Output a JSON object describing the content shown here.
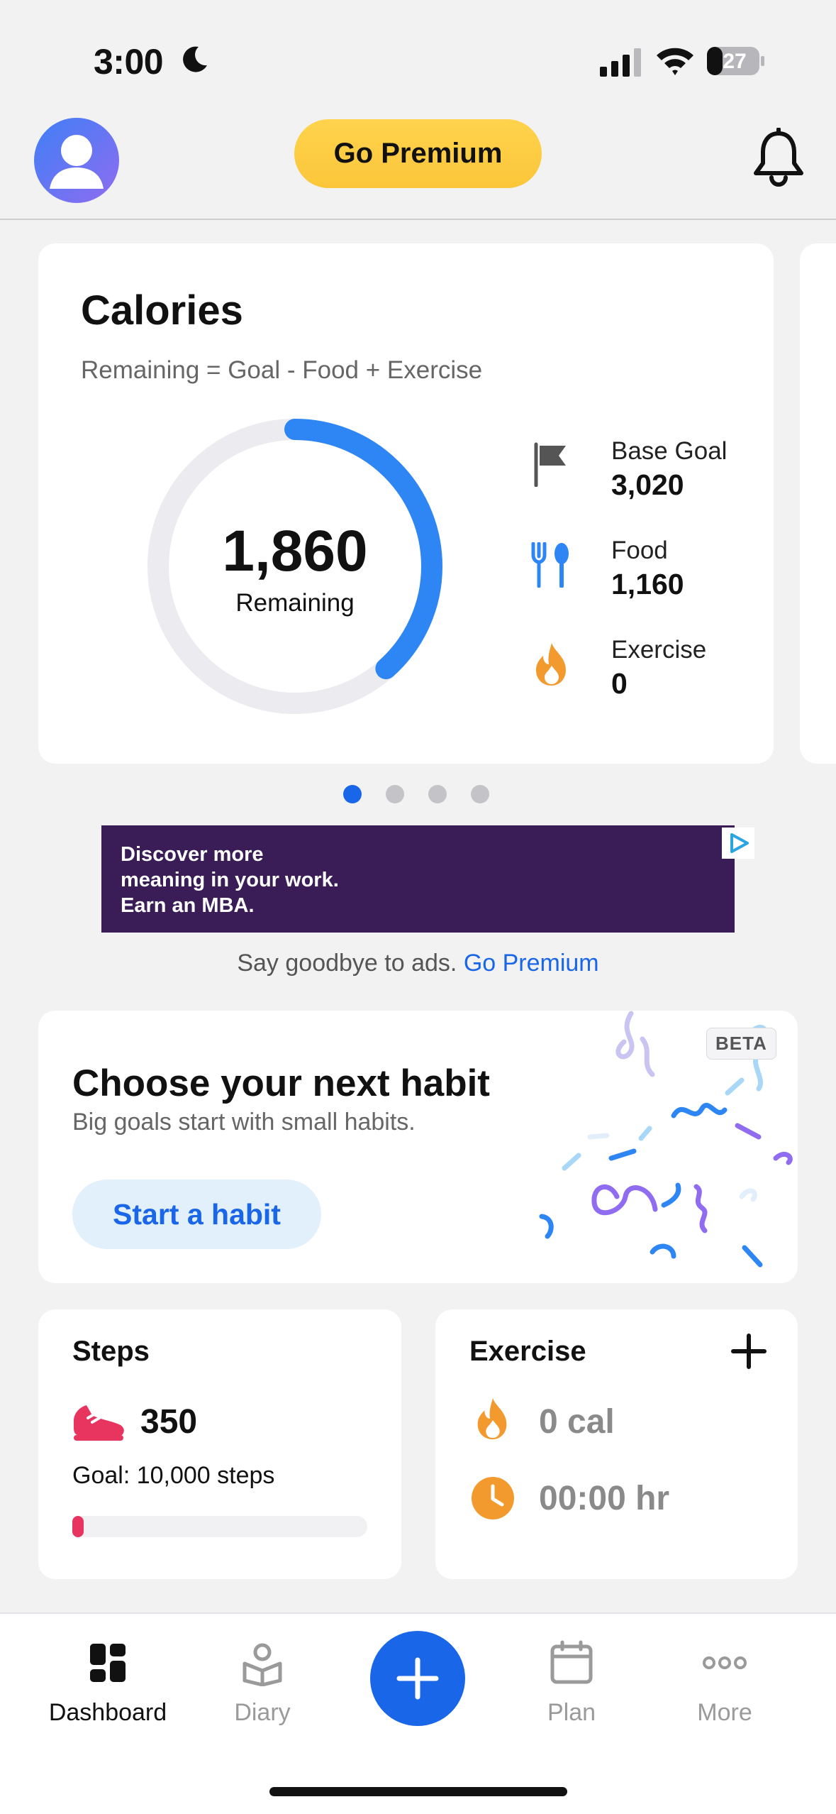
{
  "status_bar": {
    "time": "3:00",
    "battery": "27"
  },
  "header": {
    "premium_label": "Go Premium"
  },
  "calories": {
    "title": "Calories",
    "subtitle": "Remaining = Goal - Food + Exercise",
    "remaining_value": "1,860",
    "remaining_label": "Remaining",
    "ring_progress": 0.384,
    "stats": [
      {
        "label": "Base Goal",
        "value": "3,020",
        "icon": "flag-icon"
      },
      {
        "label": "Food",
        "value": "1,160",
        "icon": "fork-knife-icon"
      },
      {
        "label": "Exercise",
        "value": "0",
        "icon": "flame-icon"
      }
    ],
    "carousel_pages": 4,
    "carousel_active": 0
  },
  "ad": {
    "line1": "Discover more",
    "line2": "meaning in your work.",
    "line3": "Earn an MBA.",
    "note": "Say goodbye to ads.",
    "note_link": "Go Premium"
  },
  "habit": {
    "badge": "BETA",
    "title": "Choose your next habit",
    "subtitle": "Big goals start with small habits.",
    "button": "Start a habit"
  },
  "steps": {
    "title": "Steps",
    "value": "350",
    "goal": "Goal: 10,000 steps",
    "progress": 0.035
  },
  "exercise": {
    "title": "Exercise",
    "calories": "0 cal",
    "duration": "00:00 hr"
  },
  "tabbar": {
    "tabs": [
      {
        "label": "Dashboard",
        "icon": "dashboard-icon",
        "active": true
      },
      {
        "label": "Diary",
        "icon": "diary-icon",
        "active": false
      },
      {
        "label": "Plan",
        "icon": "calendar-icon",
        "active": false
      },
      {
        "label": "More",
        "icon": "more-icon",
        "active": false
      }
    ]
  },
  "colors": {
    "accent": "#1a66e8",
    "premium": "#fbc63a",
    "flame": "#f39a2e",
    "steps": "#e8355f"
  }
}
